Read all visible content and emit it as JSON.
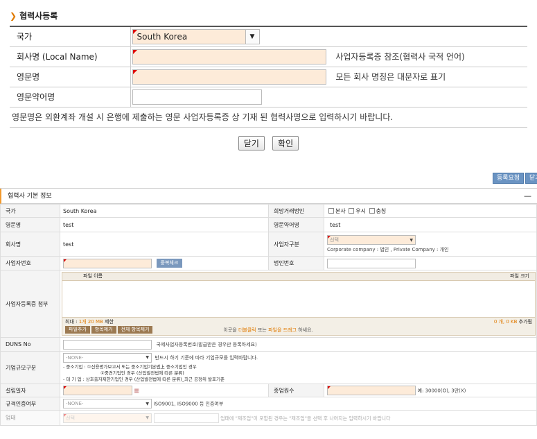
{
  "form": {
    "title": "협력사등록",
    "rows": [
      {
        "label": "국가",
        "value": "South Korea"
      },
      {
        "label": "회사명 (Local Name)",
        "hint": "사업자등록증 참조(협력사 국적 언어)"
      },
      {
        "label": "영문명",
        "hint": "모든 회사 명칭은 대문자로 표기"
      },
      {
        "label": "영문약어명"
      }
    ],
    "note": "영문명은 외환계좌 개설 시 은행에 제출하는 영문 사업자등록증 상 기재 된 협력사명으로 입력하시기 바랍니다.",
    "close_label": "닫기",
    "confirm_label": "확인"
  },
  "toolbar": {
    "register_request": "등록요청",
    "close_short": "닫기"
  },
  "panel": {
    "title": "협력사 기본 정보",
    "minimize": "—",
    "country_label": "국가",
    "country_value": "South Korea",
    "desired_entity_label": "희망거래법인",
    "entity_options": [
      "본사",
      "우시",
      "충칭"
    ],
    "eng_name_label": "영문명",
    "eng_name_value": "test",
    "eng_abbr_label": "영문약어명",
    "eng_abbr_value": "test",
    "company_label": "회사명",
    "company_value": "test",
    "biz_type_label": "사업자구분",
    "biz_type_placeholder": "선택",
    "biz_type_note": "Corporate company : 법인 , Private Company : 개인",
    "biz_no_label": "사업자번호",
    "dup_check": "중복체크",
    "corp_no_label": "법인번호",
    "attach_label": "사업자등록증 첨부",
    "file_col_name": "파일 이름",
    "file_col_size": "파일 크기",
    "file_limit_prefix": "최대 : ",
    "file_limit_count": "1개 20 MB",
    "file_limit_suffix": " 제한",
    "file_count_value": "0 개, 0 KB",
    "file_count_suffix": " 추가됨",
    "add_file": "파일추가",
    "remove_item": "항목제거",
    "remove_all": "전체 항목제거",
    "drop_hint_pre": "이곳을 ",
    "drop_hint_dbl": "더블클릭",
    "drop_hint_mid": " 또는 ",
    "drop_hint_drag": "파일을 드래그",
    "drop_hint_post": " 하세요.",
    "duns_label": "DUNS No",
    "duns_hint": "국제사업자등록번호(발급받은 경우만 등록하세요)",
    "scale_label": "기업규모구분",
    "scale_placeholder": "-NONE-",
    "scale_hint": "반드시 하기 기준에 따라 기업규모를 입력바랍니다.",
    "scale_note1": "- 중소기업 : ①신용평가보고서 또는 중소기업기본법上 중소기업인 경우",
    "scale_note2": "②중견기업인 경우 (산업발전법에 따른 분류)",
    "scale_note3": "- 대 기 업 : 상호출자제한기업인 경우 (산업발전법에 따른 분류)_최근 공정위 발표기준",
    "est_label": "설립일자",
    "emp_label": "종업원수",
    "emp_hint": "예: 30000(O), 3만(X)",
    "cert_label": "규격인증여부",
    "cert_placeholder": "-NONE-",
    "cert_hint": "ISO9001, ISO9000 등 인증여부",
    "industry_label": "업태",
    "industry_placeholder": "선택",
    "industry_hint": "업태에 \"제조업\"이 포함된 경우는 \"제조업\"을 선택 후 나머지는 입력하시기 바랍니다"
  },
  "colors": {
    "accent_orange": "#e07a00",
    "required_fill": "#fdebd9",
    "blue_button": "#6a93c2",
    "brown_button": "#9c7a52"
  }
}
